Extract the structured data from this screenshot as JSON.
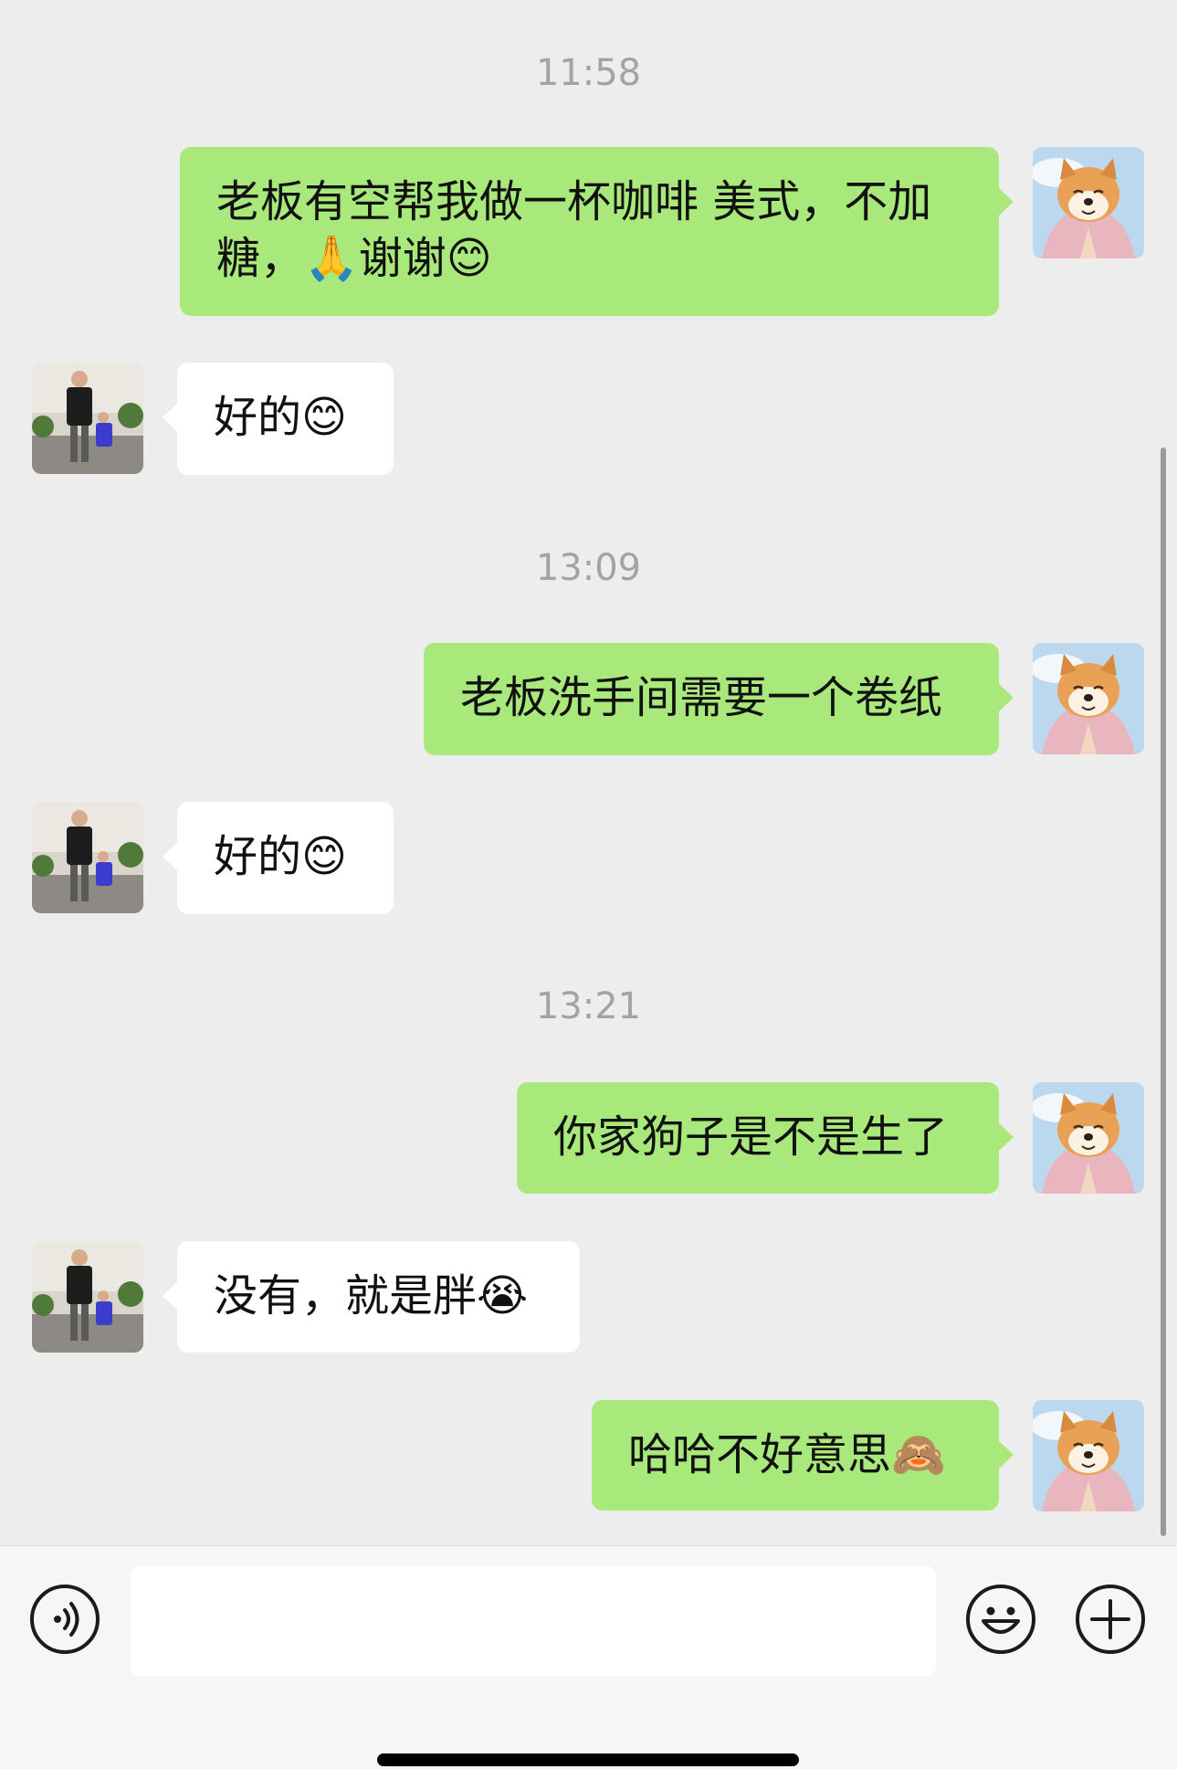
{
  "messages": [
    {
      "kind": "time",
      "text": "11:58"
    },
    {
      "kind": "me",
      "text": "老板有空帮我做一杯咖啡 美式，不加糖，🙏谢谢😊"
    },
    {
      "kind": "other",
      "text": "好的😊"
    },
    {
      "kind": "time",
      "text": "13:09"
    },
    {
      "kind": "me",
      "text": "老板洗手间需要一个卷纸"
    },
    {
      "kind": "other",
      "text": "好的😊"
    },
    {
      "kind": "time",
      "text": "13:21"
    },
    {
      "kind": "me",
      "text": "你家狗子是不是生了"
    },
    {
      "kind": "other",
      "text": "没有，就是胖😭"
    },
    {
      "kind": "me",
      "text": "哈哈不好意思🙈"
    }
  ],
  "input": {
    "value": "",
    "placeholder": ""
  },
  "icons": {
    "voice": "voice-icon",
    "emoji": "emoji-icon",
    "more": "plus-icon"
  },
  "colors": {
    "my_bubble": "#a9e97b",
    "other_bubble": "#ffffff",
    "background": "#ededed",
    "timestamp": "#a3a3a3"
  }
}
